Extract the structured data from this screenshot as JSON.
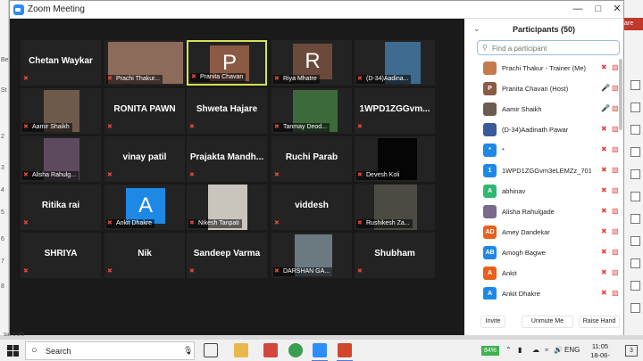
{
  "window": {
    "title": "Zoom Meeting"
  },
  "background": {
    "right_tab": "are",
    "left_labels": [
      "Be",
      "St",
      "2",
      "3",
      "4",
      "5",
      "6",
      "7",
      "8"
    ],
    "status_text": "Stre 1 of 9"
  },
  "tiles": [
    {
      "label": "Chetan Waykar",
      "kind": "name"
    },
    {
      "label": "Prachi Thakur...",
      "kind": "photo"
    },
    {
      "label": "Pranita Chavan",
      "kind": "letter",
      "letter": "P",
      "color": "#8a5a44"
    },
    {
      "label": "Riya Mhatre",
      "kind": "letter",
      "letter": "R",
      "color": "#6b4a3c"
    },
    {
      "label": "(D-34)Aadina...",
      "kind": "photo"
    },
    {
      "label": "Aamir Shaikh",
      "kind": "photo"
    },
    {
      "label": "RONITA PAWN",
      "kind": "name"
    },
    {
      "label": "Shweta Hajare",
      "kind": "name"
    },
    {
      "label": "Tanmay Deod...",
      "kind": "photo"
    },
    {
      "label": "1WPD1ZGGvm...",
      "kind": "name"
    },
    {
      "label": "Alisha Rahulg...",
      "kind": "photo"
    },
    {
      "label": "vinay patil",
      "kind": "name"
    },
    {
      "label": "Prajakta Mandh...",
      "kind": "name"
    },
    {
      "label": "Ruchi Parab",
      "kind": "name"
    },
    {
      "label": "Devesh Koli",
      "kind": "photo"
    },
    {
      "label": "Ritika rai",
      "kind": "name"
    },
    {
      "label": "Ankit Dhakre",
      "kind": "letter",
      "letter": "A",
      "color": "#1e88e5"
    },
    {
      "label": "Nikesh Tanpati",
      "kind": "photo"
    },
    {
      "label": "viddesh",
      "kind": "name"
    },
    {
      "label": "Rushikesh Za...",
      "kind": "photo"
    },
    {
      "label": "SHRIYA",
      "kind": "name"
    },
    {
      "label": "Nik",
      "kind": "name"
    },
    {
      "label": "Sandeep Varma",
      "kind": "name"
    },
    {
      "label": "DARSHAN GA...",
      "kind": "photo"
    },
    {
      "label": "Shubham",
      "kind": "name"
    }
  ],
  "participants_panel": {
    "title": "Participants (50)",
    "search_placeholder": "Find a participant",
    "participants": [
      {
        "name": "Prachi Thakur - Trainer (Me)",
        "initials": "",
        "color": "#c57a4e",
        "mic": "muted",
        "cam": "off"
      },
      {
        "name": "Pranita Chavan (Host)",
        "initials": "P",
        "color": "#8a5a44",
        "mic": "on",
        "cam": "off"
      },
      {
        "name": "Aamir Shaikh",
        "initials": "",
        "color": "#6d5b4f",
        "mic": "on",
        "cam": "off"
      },
      {
        "name": "(D-34)Aadinath Pawar",
        "initials": "",
        "color": "#3b5998",
        "mic": "muted",
        "cam": "off"
      },
      {
        "name": "*",
        "initials": "*",
        "color": "#1e88e5",
        "mic": "muted",
        "cam": "off"
      },
      {
        "name": "1WPD1ZGGvm3eLEMZz_701Sw...",
        "initials": "1",
        "color": "#1e88e5",
        "mic": "muted",
        "cam": "off"
      },
      {
        "name": "abhinav",
        "initials": "A",
        "color": "#2eb872",
        "mic": "muted",
        "cam": "off"
      },
      {
        "name": "Alisha Rahulgade",
        "initials": "",
        "color": "#7a6a8c",
        "mic": "muted",
        "cam": "off"
      },
      {
        "name": "Amey Dandekar",
        "initials": "AD",
        "color": "#e8601c",
        "mic": "muted",
        "cam": "off"
      },
      {
        "name": "Amogh Bagwe",
        "initials": "AB",
        "color": "#1e88e5",
        "mic": "muted",
        "cam": "off"
      },
      {
        "name": "Ankit",
        "initials": "A",
        "color": "#e8601c",
        "mic": "muted",
        "cam": "off"
      },
      {
        "name": "Ankit Dhakre",
        "initials": "A",
        "color": "#1e88e5",
        "mic": "muted",
        "cam": "off"
      }
    ],
    "footer": {
      "invite": "Invite",
      "unmute": "Unmute Me",
      "raise": "Raise Hand"
    }
  },
  "taskbar": {
    "search_text": "Search",
    "battery": "84%",
    "language": "ENG",
    "time": "11:05",
    "date": "18-06-2020",
    "notif_count": "3"
  }
}
